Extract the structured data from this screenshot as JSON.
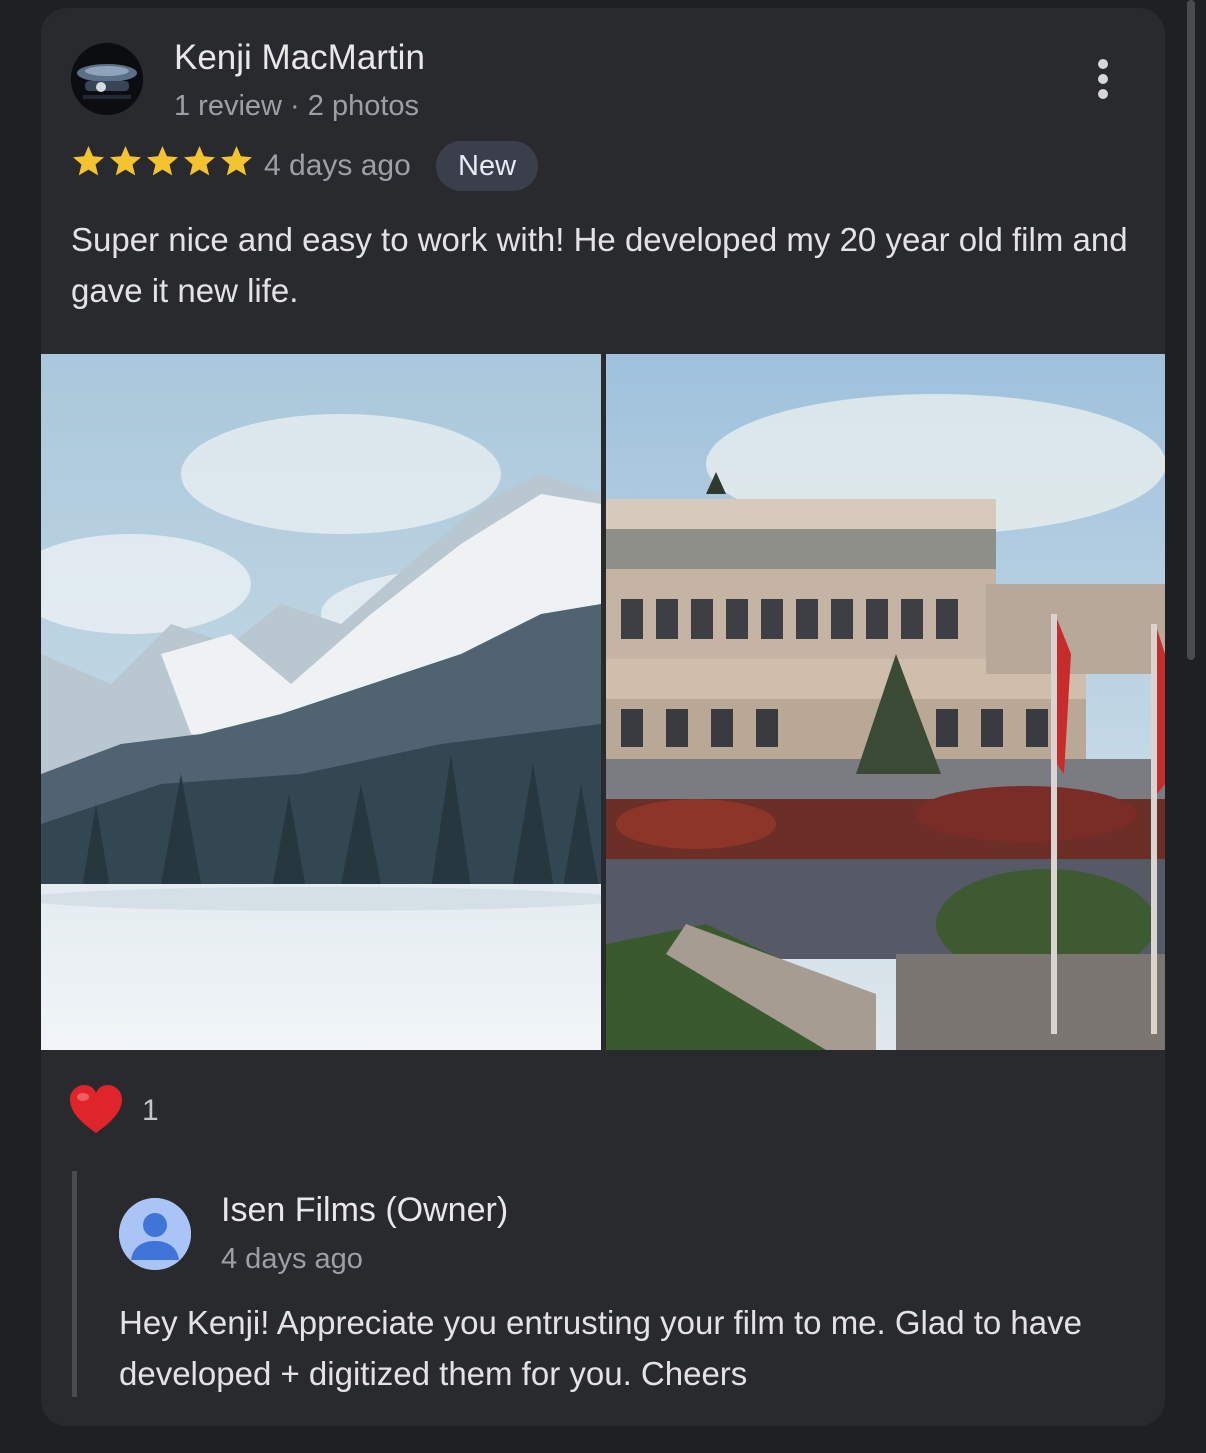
{
  "review": {
    "author": "Kenji MacMartin",
    "author_meta": "1 review · 2 photos",
    "rating": 5,
    "time": "4 days ago",
    "badge": "New",
    "text": "Super nice and easy to work with! He developed my 20 year old film and gave it new life.",
    "photos": [
      {
        "icon": "snowy-mountain-forest-photo"
      },
      {
        "icon": "campus-building-flags-photo"
      }
    ],
    "reactions": {
      "icon": "red-heart-icon",
      "count": "1"
    },
    "more_icon": "more-vert-icon"
  },
  "owner_reply": {
    "author": "Isen Films (Owner)",
    "time": "4 days ago",
    "text": "Hey Kenji! Appreciate you entrusting your film to me. Glad to have developed + digitized them for you. Cheers",
    "avatar_icon": "person-icon"
  },
  "colors": {
    "background": "#1f2022",
    "card": "#292a2d",
    "star": "#f4c430",
    "badge_bg": "#3b3f4c",
    "secondary_text": "#9aa0a6",
    "heart": "#e0242b",
    "owner_avatar": "#a9c4f5",
    "owner_avatar_figure": "#3f74d9"
  }
}
